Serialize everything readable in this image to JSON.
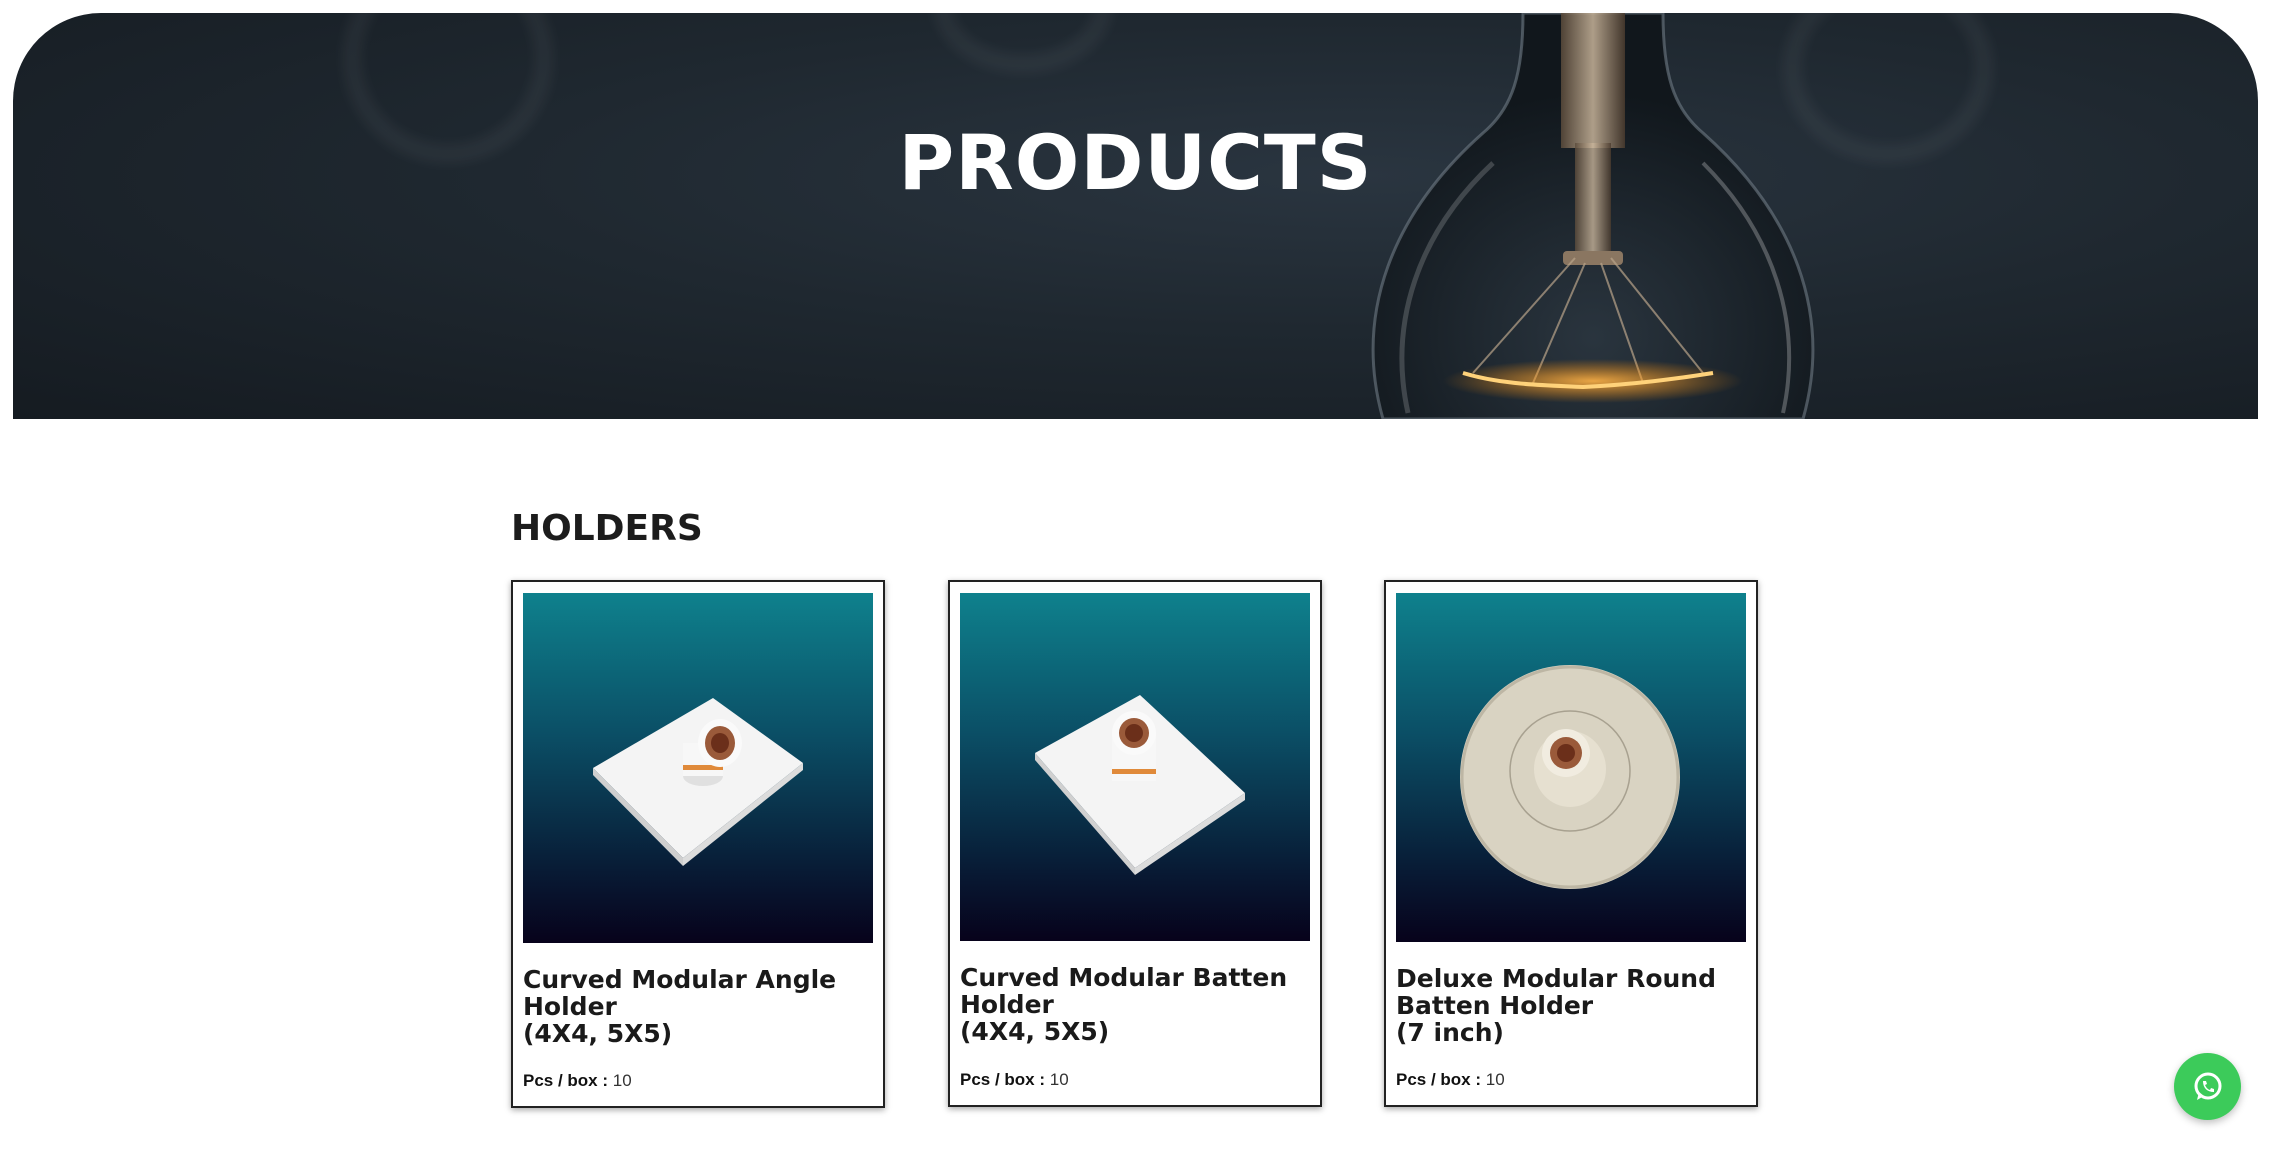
{
  "hero": {
    "title": "PRODUCTS"
  },
  "section": {
    "title": "HOLDERS"
  },
  "products": [
    {
      "name_line1": "Curved Modular Angle",
      "name_line2": "Holder",
      "name_line3": "(4X4, 5X5)",
      "pcs_label": "Pcs / box :",
      "pcs_value": "10",
      "image_icon": "angle-holder-image"
    },
    {
      "name_line1": "Curved Modular Batten",
      "name_line2": "Holder",
      "name_line3": "(4X4, 5X5)",
      "pcs_label": "Pcs / box :",
      "pcs_value": "10",
      "image_icon": "batten-holder-image"
    },
    {
      "name_line1": "Deluxe Modular Round",
      "name_line2": "Batten Holder",
      "name_line3": "(7 inch)",
      "pcs_label": "Pcs / box :",
      "pcs_value": "10",
      "image_icon": "round-batten-holder-image"
    }
  ],
  "colors": {
    "hero_bg": "#1f2830",
    "card_gradient_top": "#0e818d",
    "card_gradient_bottom": "#07021b",
    "whatsapp_green": "#3ccb5a"
  },
  "floating": {
    "icon": "whatsapp-icon"
  }
}
